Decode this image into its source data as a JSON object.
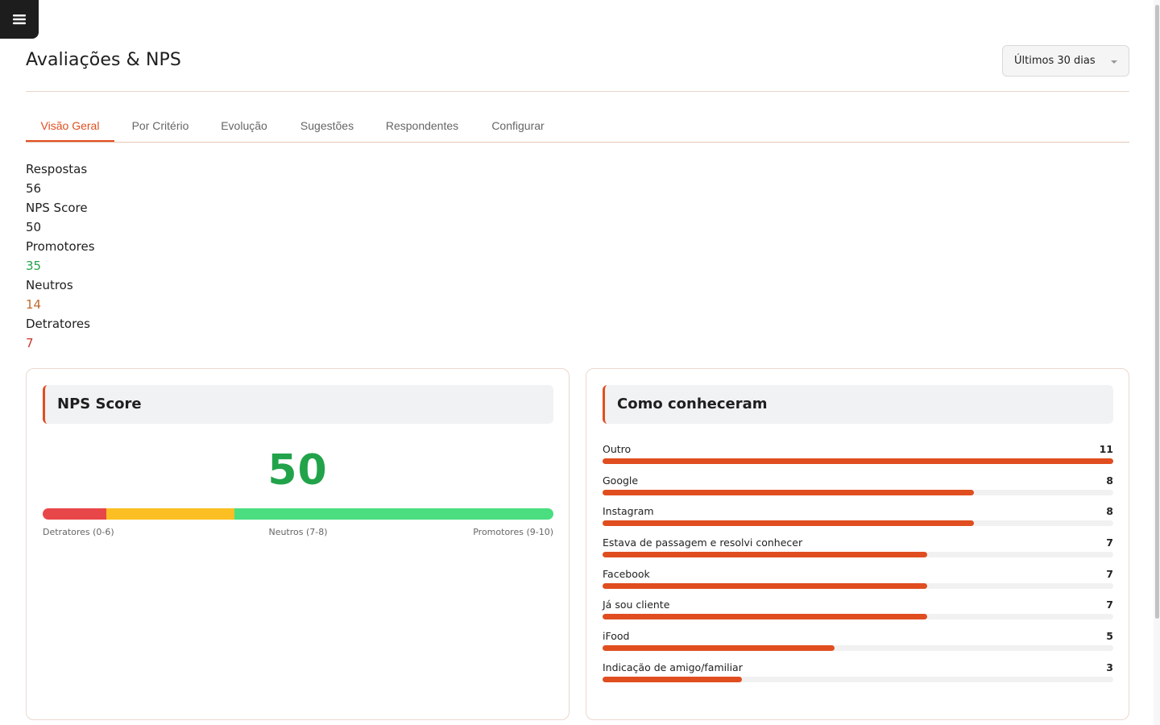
{
  "header": {
    "title": "Avaliações & NPS",
    "period_select": {
      "selected": "Últimos 30 dias"
    }
  },
  "tabs": [
    {
      "label": "Visão Geral",
      "active": true
    },
    {
      "label": "Por Critério",
      "active": false
    },
    {
      "label": "Evolução",
      "active": false
    },
    {
      "label": "Sugestões",
      "active": false
    },
    {
      "label": "Respondentes",
      "active": false
    },
    {
      "label": "Configurar",
      "active": false
    }
  ],
  "summary": {
    "responses_label": "Respostas",
    "responses_value": "56",
    "nps_label": "NPS Score",
    "nps_value": "50",
    "promoters_label": "Promotores",
    "promoters_value": "35",
    "neutrals_label": "Neutros",
    "neutrals_value": "14",
    "detractors_label": "Detratores",
    "detractors_value": "7"
  },
  "nps_card": {
    "title": "NPS Score",
    "score": "50",
    "segments": [
      {
        "key": "detractors",
        "label": "Detratores (0-6)",
        "share": 0.125,
        "color": "#e8474a"
      },
      {
        "key": "neutrals",
        "label": "Neutros (7-8)",
        "share": 0.25,
        "color": "#fbbf24"
      },
      {
        "key": "promoters",
        "label": "Promotores (9-10)",
        "share": 0.625,
        "color": "#4ade80"
      }
    ]
  },
  "sources_card": {
    "title": "Como conheceram",
    "max": 11,
    "bar_color": "#e04e20",
    "items": [
      {
        "label": "Outro",
        "count": 11
      },
      {
        "label": "Google",
        "count": 8
      },
      {
        "label": "Instagram",
        "count": 8
      },
      {
        "label": "Estava de passagem e resolvi conhecer",
        "count": 7
      },
      {
        "label": "Facebook",
        "count": 7
      },
      {
        "label": "Já sou cliente",
        "count": 7
      },
      {
        "label": "iFood",
        "count": 5
      },
      {
        "label": "Indicação de amigo/familiar",
        "count": 3
      }
    ]
  },
  "icons": {
    "menu": "hamburger-menu-icon"
  }
}
